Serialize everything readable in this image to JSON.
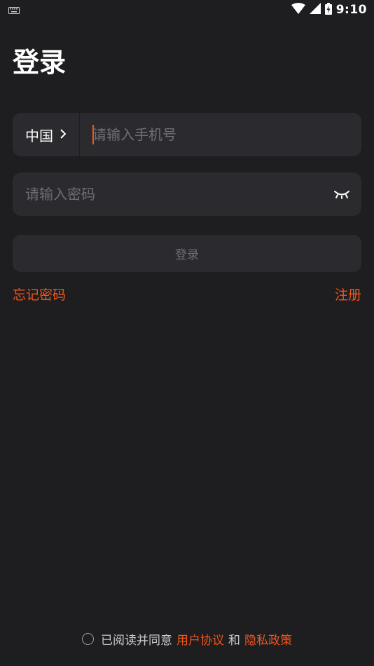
{
  "status_bar": {
    "time": "9:10",
    "icons": [
      "keyboard-icon",
      "wifi-icon",
      "signal-icon",
      "battery-icon"
    ]
  },
  "title": "登录",
  "phone_field": {
    "country": "中国",
    "placeholder": "请输入手机号",
    "value": ""
  },
  "password_field": {
    "placeholder": "请输入密码",
    "value": ""
  },
  "login_button": {
    "label": "登录"
  },
  "links": {
    "forgot_password": "忘记密码",
    "register": "注册"
  },
  "agreement": {
    "prefix": "已阅读并同意",
    "user_agreement": "用户协议",
    "and": "和",
    "privacy_policy": "隐私政策",
    "checked": false
  },
  "colors": {
    "background": "#1e1e20",
    "field": "#2b2b2f",
    "accent": "#f2541a",
    "placeholder": "#6e6e73"
  }
}
